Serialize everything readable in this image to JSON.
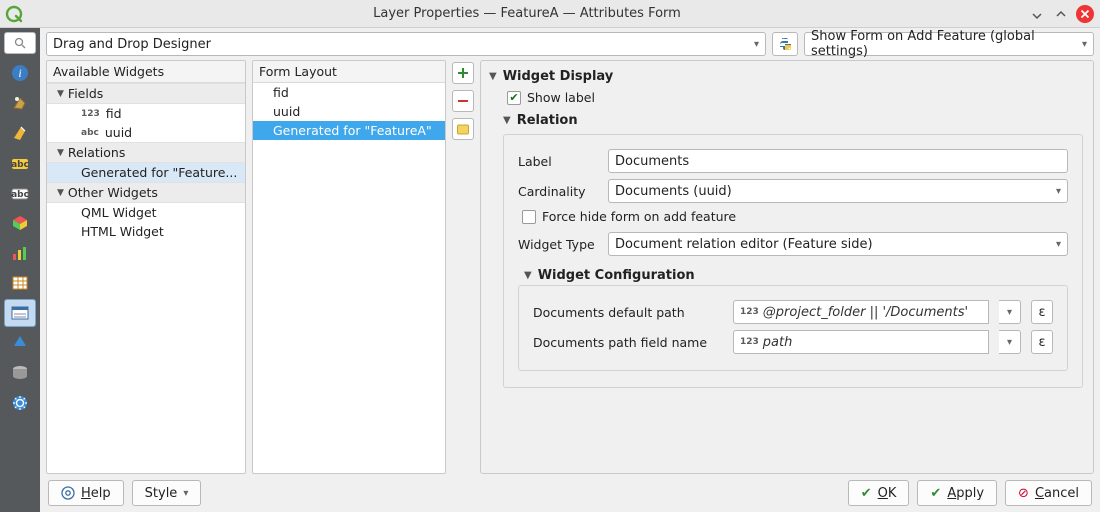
{
  "title": "Layer Properties — FeatureA — Attributes Form",
  "topbar": {
    "editor_mode": "Drag and Drop Designer",
    "form_on_add": "Show Form on Add Feature (global settings)"
  },
  "available": {
    "header": "Available Widgets",
    "groups": [
      {
        "label": "Fields",
        "items": [
          {
            "badge": "123",
            "label": "fid"
          },
          {
            "badge": "abc",
            "label": "uuid"
          }
        ]
      },
      {
        "label": "Relations",
        "items": [
          {
            "label": "Generated for \"Feature...",
            "selected": true
          }
        ]
      },
      {
        "label": "Other Widgets",
        "items": [
          {
            "label": "QML Widget"
          },
          {
            "label": "HTML Widget"
          }
        ]
      }
    ]
  },
  "layout": {
    "header": "Form Layout",
    "items": [
      {
        "label": "fid"
      },
      {
        "label": "uuid"
      },
      {
        "label": "Generated for \"FeatureA\"",
        "selected": true
      }
    ]
  },
  "detail": {
    "widget_display": "Widget Display",
    "show_label": {
      "label": "Show label",
      "checked": true
    },
    "relation_header": "Relation",
    "label_lbl": "Label",
    "label_value": "Documents",
    "cardinality_lbl": "Cardinality",
    "cardinality_value": "Documents (uuid)",
    "force_hide": {
      "label": "Force hide form on add feature",
      "checked": false
    },
    "widget_type_lbl": "Widget Type",
    "widget_type_value": "Document relation editor (Feature side)",
    "widget_config_header": "Widget Configuration",
    "default_path_lbl": "Documents default path",
    "default_path_value": "@project_folder || '/Documents'",
    "path_field_lbl": "Documents path field name",
    "path_field_value": "path",
    "epsilon": "ε"
  },
  "buttons": {
    "help": "Help",
    "style": "Style",
    "ok": "OK",
    "apply": "Apply",
    "cancel": "Cancel"
  }
}
